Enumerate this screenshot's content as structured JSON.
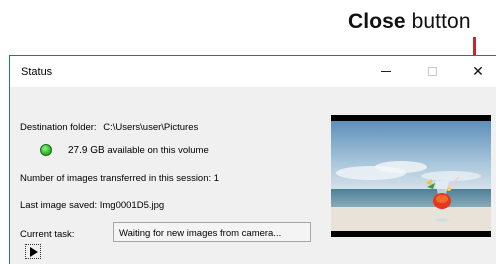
{
  "callout": {
    "close_bold": "Close",
    "close_rest": " button"
  },
  "window": {
    "title": "Status",
    "close_glyph": "✕"
  },
  "status": {
    "destination_label": "Destination folder:",
    "destination_value": "C:\\Users\\user\\Pictures",
    "free_space": "27.9 GB",
    "free_space_suffix": "available on this volume",
    "images_label": "Number of images transferred in this session:",
    "images_count": "1",
    "last_saved_label": "Last image saved:",
    "last_saved_value": "Img0001D5.jpg",
    "current_task_label": "Current task:",
    "current_task_value": "Waiting for new images from camera..."
  },
  "icons": {
    "close": "close-icon",
    "minimize": "minimize-icon",
    "maximize": "maximize-icon",
    "status_led": "status-led-icon",
    "play": "play-icon"
  },
  "colors": {
    "callout_line": "#c62828",
    "window_border": "#2b6cb0",
    "status_led": "#2fbf2f",
    "content_bg": "#f0f0f0"
  }
}
